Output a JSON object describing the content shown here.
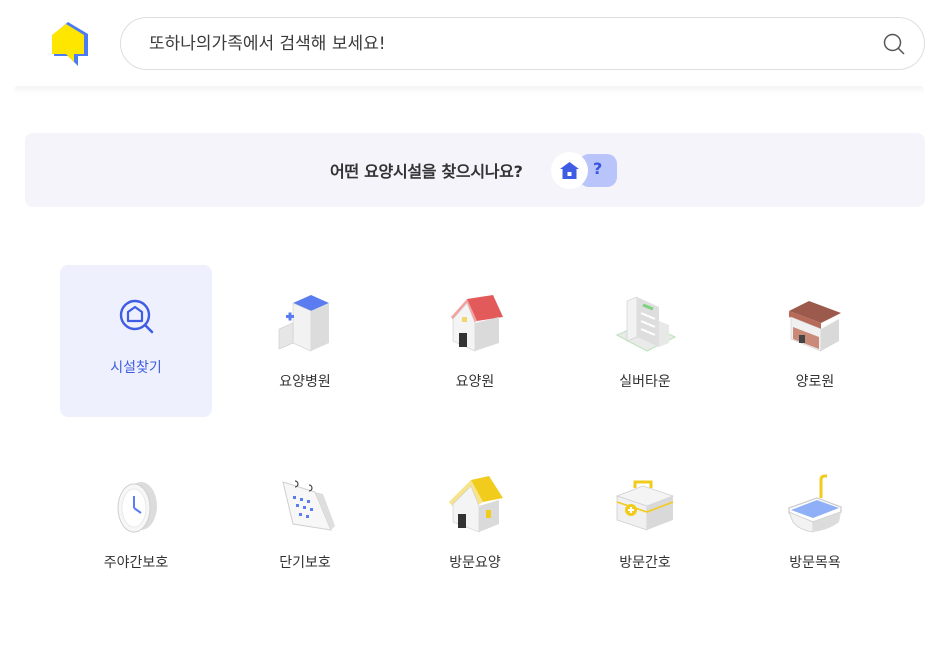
{
  "search": {
    "placeholder": "또하나의가족에서 검색해 보세요!"
  },
  "banner": {
    "question": "어떤 요양시설을 찾으시나요?",
    "help_mark": "?"
  },
  "colors": {
    "accent": "#3e5ce4",
    "active_bg": "#eef1fd",
    "banner_bg": "#f4f4fa",
    "logo_yellow": "#ffe600",
    "logo_blue": "#4d7bf3"
  },
  "categories": [
    {
      "label": "시설찾기",
      "icon": "facility-search-icon",
      "active": true
    },
    {
      "label": "요양병원",
      "icon": "nursing-hospital-icon"
    },
    {
      "label": "요양원",
      "icon": "nursing-home-icon"
    },
    {
      "label": "실버타운",
      "icon": "silver-town-icon"
    },
    {
      "label": "양로원",
      "icon": "elderly-home-icon"
    },
    {
      "label": "주야간보호",
      "icon": "day-night-care-icon"
    },
    {
      "label": "단기보호",
      "icon": "short-term-care-icon"
    },
    {
      "label": "방문요양",
      "icon": "visiting-care-icon"
    },
    {
      "label": "방문간호",
      "icon": "visiting-nursing-icon"
    },
    {
      "label": "방문목욕",
      "icon": "visiting-bath-icon"
    }
  ]
}
